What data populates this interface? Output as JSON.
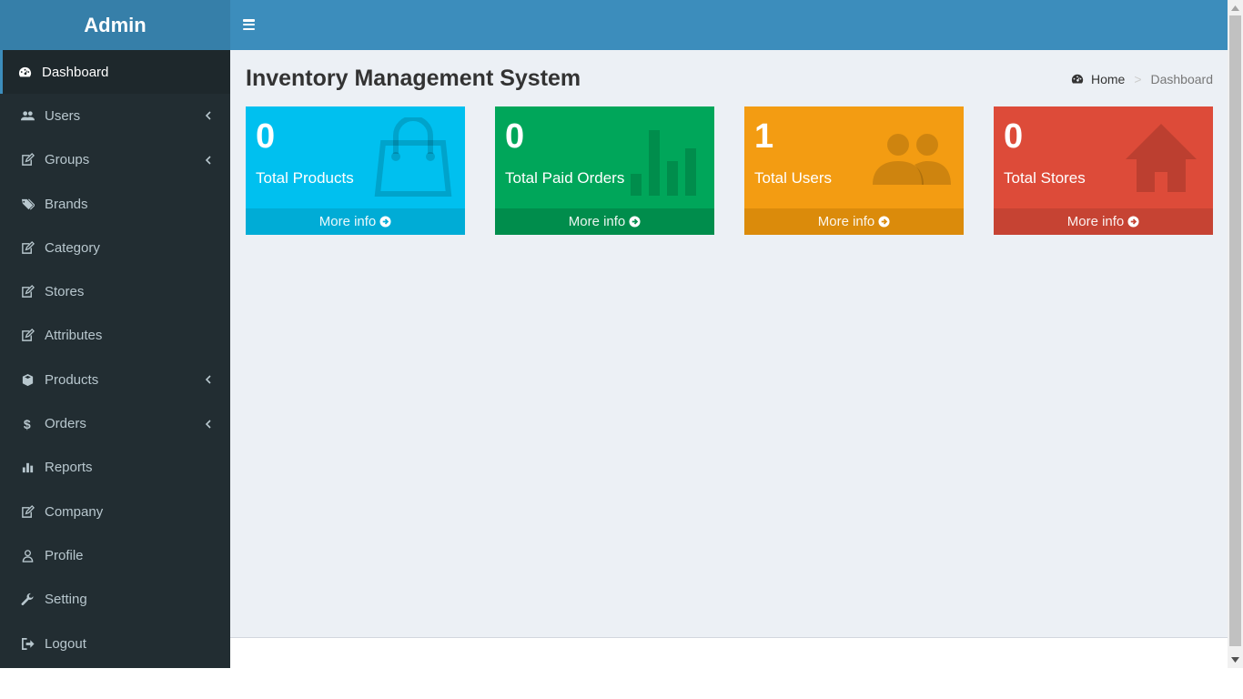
{
  "sidebar": {
    "logo": "Admin",
    "items": [
      {
        "label": "Dashboard",
        "icon": "dashboard-icon",
        "active": true
      },
      {
        "label": "Users",
        "icon": "users-icon",
        "chevron": true
      },
      {
        "label": "Groups",
        "icon": "edit-icon",
        "chevron": true
      },
      {
        "label": "Brands",
        "icon": "tags-icon"
      },
      {
        "label": "Category",
        "icon": "edit-icon"
      },
      {
        "label": "Stores",
        "icon": "edit-icon"
      },
      {
        "label": "Attributes",
        "icon": "edit-icon"
      },
      {
        "label": "Products",
        "icon": "cube-icon",
        "chevron": true
      },
      {
        "label": "Orders",
        "icon": "dollar-icon",
        "chevron": true
      },
      {
        "label": "Reports",
        "icon": "bar-chart-icon"
      },
      {
        "label": "Company",
        "icon": "edit-icon"
      },
      {
        "label": "Profile",
        "icon": "user-icon"
      },
      {
        "label": "Setting",
        "icon": "wrench-icon"
      },
      {
        "label": "Logout",
        "icon": "sign-out-icon"
      }
    ]
  },
  "header": {
    "page_title": "Inventory Management System",
    "breadcrumb": {
      "home": "Home",
      "current": "Dashboard"
    }
  },
  "boxes": [
    {
      "value": "0",
      "label": "Total Products",
      "link": "More info",
      "color": "#00c0ef",
      "icon": "shopping-bag-icon"
    },
    {
      "value": "0",
      "label": "Total Paid Orders",
      "link": "More info",
      "color": "#00a65a",
      "icon": "bar-chart-icon"
    },
    {
      "value": "1",
      "label": "Total Users",
      "link": "More info",
      "color": "#f39c12",
      "icon": "users-icon"
    },
    {
      "value": "0",
      "label": "Total Stores",
      "link": "More info",
      "color": "#dd4b39",
      "icon": "home-icon"
    }
  ],
  "colors": {
    "sidebar_bg": "#222d32",
    "header_bg": "#3c8dbc",
    "logo_bg": "#367fa9",
    "content_bg": "#ecf0f5"
  }
}
